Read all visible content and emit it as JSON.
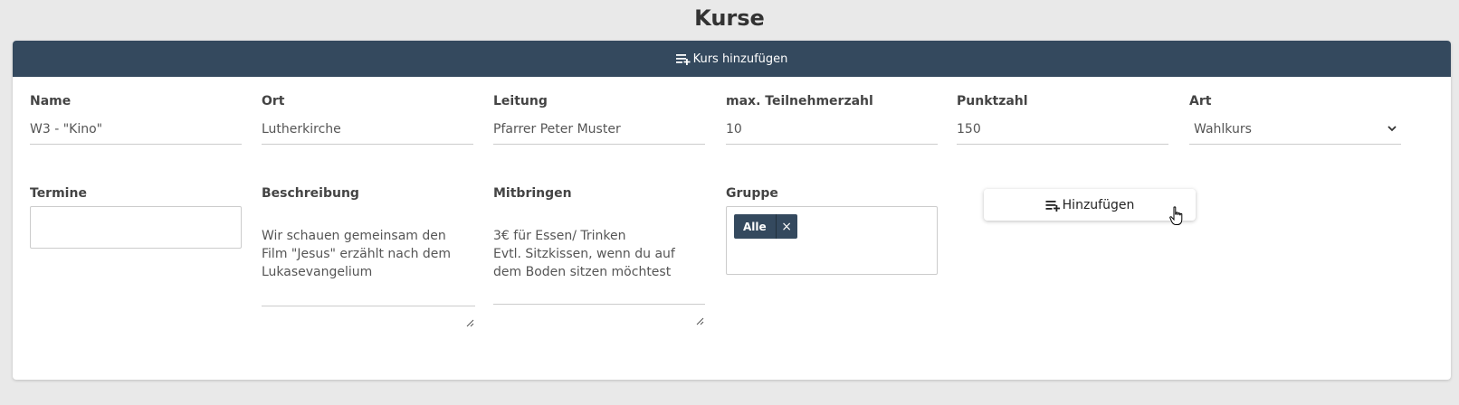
{
  "page": {
    "title": "Kurse"
  },
  "header": {
    "label": "Kurs hinzufügen",
    "icon": "playlist-add-icon"
  },
  "fields": {
    "name": {
      "label": "Name",
      "value": "W3 - \"Kino\""
    },
    "ort": {
      "label": "Ort",
      "value": "Lutherkirche"
    },
    "leitung": {
      "label": "Leitung",
      "value": "Pfarrer Peter Muster"
    },
    "max": {
      "label": "max. Teilnehmerzahl",
      "value": "10"
    },
    "punktzahl": {
      "label": "Punktzahl",
      "value": "150"
    },
    "art": {
      "label": "Art",
      "value": "Wahlkurs"
    },
    "termine": {
      "label": "Termine",
      "value": ""
    },
    "beschreibung": {
      "label": "Beschreibung",
      "value": "Wir schauen gemeinsam den\nFilm \"Jesus\" erzählt nach dem\nLukasevangelium"
    },
    "mitbringen": {
      "label": "Mitbringen",
      "value": "3€ für Essen/ Trinken\nEvtl. Sitzkissen, wenn du auf\ndem Boden sitzen möchtest"
    },
    "gruppe": {
      "label": "Gruppe",
      "tags": [
        {
          "label": "Alle",
          "remove": "×"
        }
      ]
    }
  },
  "add_button": {
    "label": "Hinzufügen",
    "icon": "playlist-add-icon"
  },
  "colors": {
    "header_bg": "#34495e",
    "tag_bg": "#34495e",
    "page_bg": "#e9e9e9"
  }
}
